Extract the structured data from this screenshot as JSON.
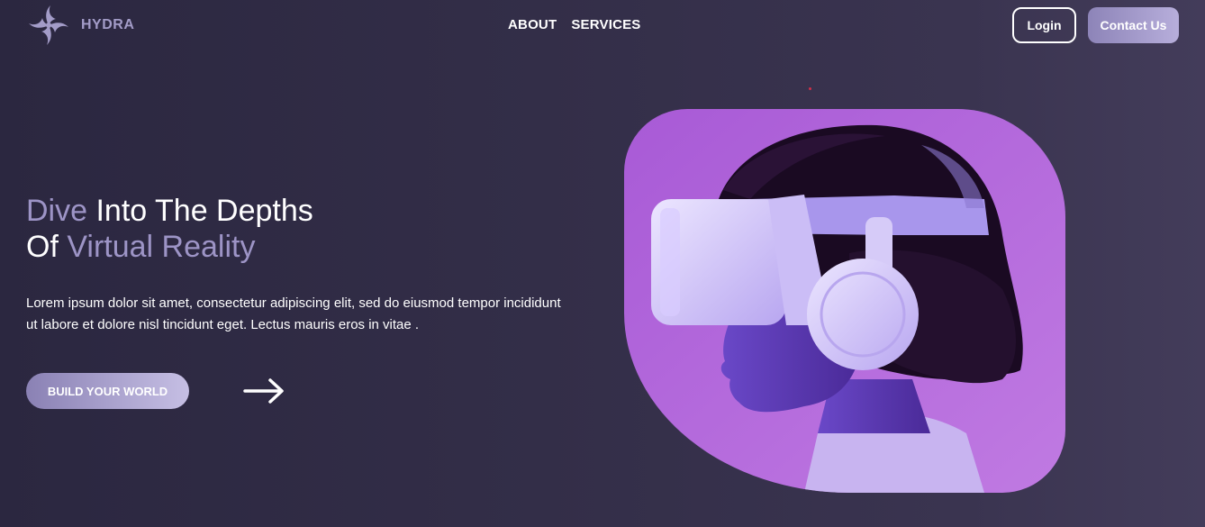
{
  "brand": {
    "name": "HYDRA",
    "logo_icon": "pinwheel-logo-icon",
    "color": "#a39cc8"
  },
  "nav": {
    "items": [
      {
        "label": "ABOUT"
      },
      {
        "label": "SERVICES"
      }
    ]
  },
  "header_actions": {
    "login_label": "Login",
    "contact_label": "Contact Us"
  },
  "hero": {
    "title_part1": "Dive",
    "title_part2": " Into The Depths",
    "title_part3": "Of",
    "title_part4": " Virtual Reality",
    "description": "Lorem ipsum dolor sit amet, consectetur adipiscing elit, sed do eiusmod tempor incididunt ut labore et dolore nisl tincidunt eget. Lectus mauris eros in vitae .",
    "cta_label": "BUILD YOUR WORLD",
    "arrow_icon": "arrow-right-icon",
    "image_icon": "vr-headset-person-image"
  },
  "colors": {
    "background": "#332e48",
    "accent": "#9d94c6",
    "image_bg": "#b060d8",
    "button_gradient_start": "#8a81b4",
    "button_gradient_end": "#c6bfe4"
  }
}
